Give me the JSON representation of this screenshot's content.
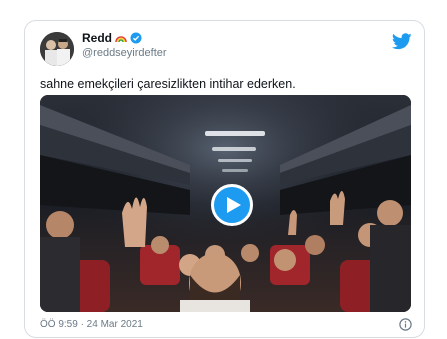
{
  "tweet": {
    "display_name": "Redd",
    "handle": "@reddseyirdefter",
    "text": "sahne emekçileri çaresizlikten intihar ederken.",
    "timestamp": "ÖÖ 9:59 · 24 Mar 2021"
  },
  "icons": {
    "brand": "twitter-bird-icon",
    "badge": "verified-icon",
    "emoji": "rainbow-icon",
    "play": "play-icon",
    "info": "info-icon"
  },
  "colors": {
    "accent": "#1d9bf0",
    "text": "#0f1419",
    "secondary": "#6b7a86",
    "border": "#d6dde3"
  }
}
